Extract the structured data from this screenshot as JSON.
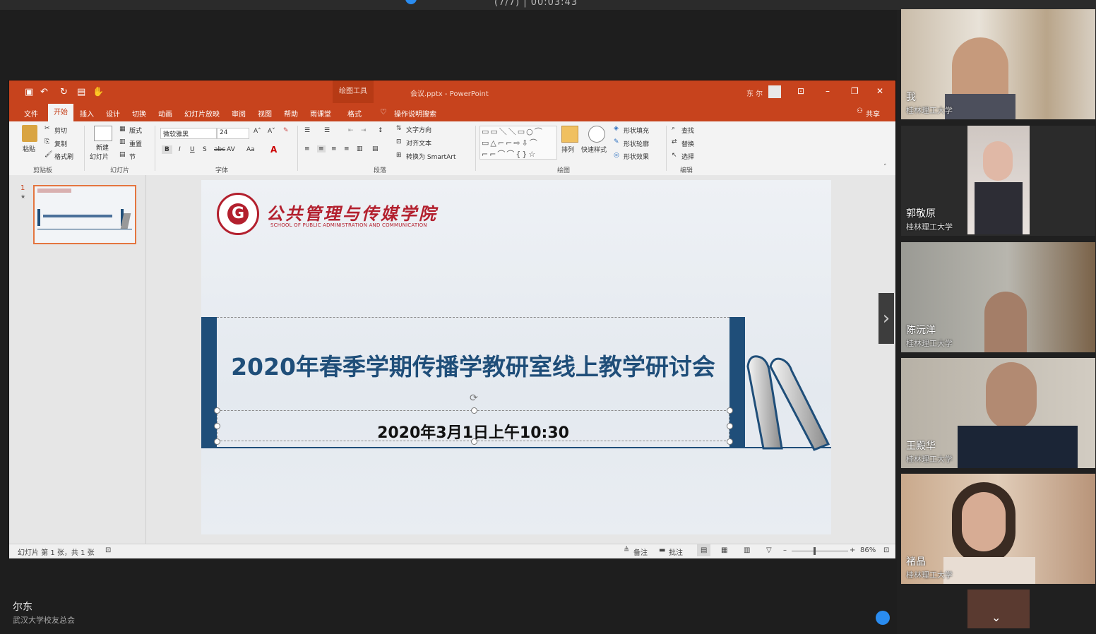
{
  "meeting": {
    "timer": "(7/7) | 00:03:43",
    "speaker_name": "尔东",
    "speaker_org": "武汉大学校友总会"
  },
  "ppt": {
    "doc_title": "会议.pptx  -  PowerPoint",
    "drawing_tools": "绘图工具",
    "user": "东 尔",
    "tabs": [
      "文件",
      "开始",
      "插入",
      "设计",
      "切换",
      "动画",
      "幻灯片放映",
      "审阅",
      "视图",
      "帮助",
      "雨课堂",
      "格式"
    ],
    "tell_me": "操作说明搜索",
    "share": "共享",
    "clipboard": {
      "paste": "粘贴",
      "cut": "剪切",
      "copy": "复制",
      "painter": "格式刷",
      "group": "剪贴板"
    },
    "slides_group": {
      "new_slide_1": "新建",
      "new_slide_2": "幻灯片",
      "layout": "版式",
      "reset": "重置",
      "section": "节",
      "group": "幻灯片"
    },
    "font_group": {
      "font_name": "微软雅黑",
      "font_size": "24",
      "group": "字体"
    },
    "paragraph_group": {
      "text_dir": "文字方向",
      "align_text": "对齐文本",
      "smartart": "转换为 SmartArt",
      "group": "段落"
    },
    "drawing_group": {
      "arrange": "排列",
      "quick_styles": "快速样式",
      "fill": "形状填充",
      "outline": "形状轮廓",
      "effects": "形状效果",
      "group": "绘图"
    },
    "editing_group": {
      "find": "查找",
      "replace": "替换",
      "select": "选择",
      "group": "编辑"
    },
    "thumb_number": "1",
    "status": {
      "slide_info": "幻灯片 第 1 张，共 1 张",
      "notes": "备注",
      "comments": "批注",
      "zoom": "86%"
    }
  },
  "slide": {
    "logo_char": "G",
    "school_cn": "公共管理与传媒学院",
    "school_en": "SCHOOL OF PUBLIC ADMINISTRATION AND COMMUNICATION",
    "title": "2020年春季学期传播学教研室线上教学研讨会",
    "date": "2020年3月1日上午10:30"
  },
  "participants": [
    {
      "name": "我",
      "org": "桂林理工大学"
    },
    {
      "name": "郭敬原",
      "org": "桂林理工大学"
    },
    {
      "name": "陈沅洋",
      "org": "桂林理工大学"
    },
    {
      "name": "王殿华",
      "org": "桂林理工大学"
    },
    {
      "name": "褚晶",
      "org": "桂林理工大学"
    }
  ]
}
